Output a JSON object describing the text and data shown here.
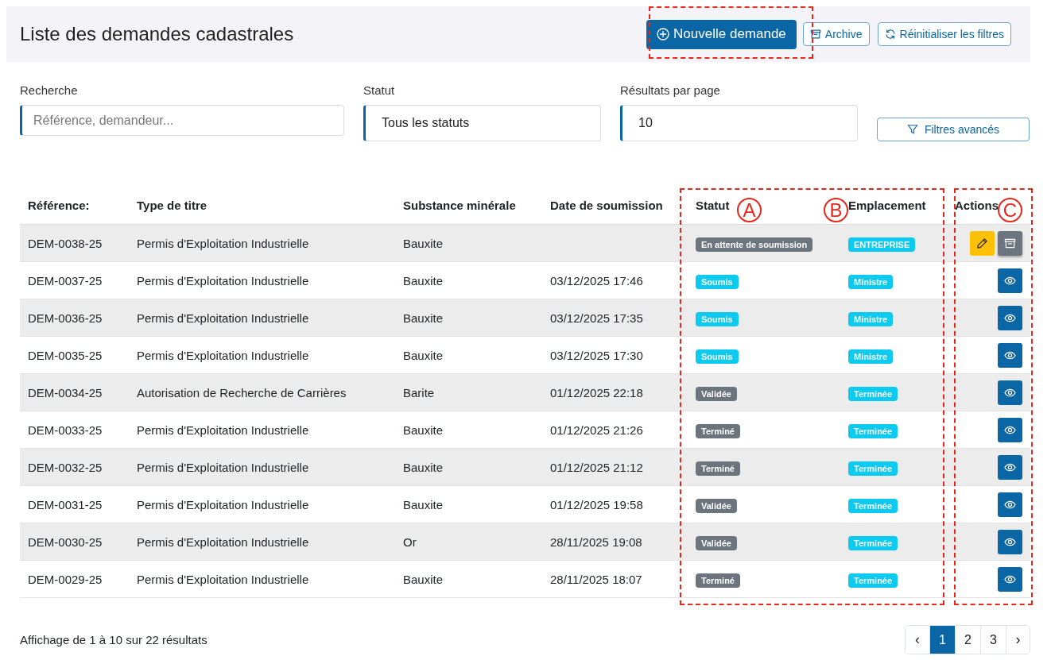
{
  "header": {
    "title": "Liste des demandes cadastrales",
    "buttons": [
      {
        "kind": "new",
        "label": "Nouvelle demande"
      },
      {
        "kind": "archive",
        "label": "Archive"
      },
      {
        "kind": "reset",
        "label": "Réinitialiser les filtres"
      }
    ]
  },
  "filters": {
    "search": {
      "label": "Recherche",
      "placeholder": "Référence, demandeur..."
    },
    "status": {
      "label": "Statut",
      "value": "Tous les statuts"
    },
    "per_page": {
      "label": "Résultats par page",
      "value": "10"
    },
    "advanced_button": "Filtres avancés"
  },
  "table": {
    "columns": [
      "Référence:",
      "Type de titre",
      "Substance minérale",
      "Date de soumission",
      "Statut",
      "Emplacement",
      "Actions"
    ],
    "rows": [
      {
        "ref": "DEM-0038-25",
        "type": "Permis d'Exploitation Industrielle",
        "substance": "Bauxite",
        "date": "",
        "status": {
          "text": "En attente de soumission",
          "color": "#6c757d"
        },
        "location": {
          "text": "ENTREPRISE",
          "color": "#0dcaf0"
        },
        "kind": "draft"
      },
      {
        "ref": "DEM-0037-25",
        "type": "Permis d'Exploitation Industrielle",
        "substance": "Bauxite",
        "date": "03/12/2025 17:46",
        "status": {
          "text": "Soumis",
          "color": "#0dcaf0"
        },
        "location": {
          "text": "Ministre",
          "color": "#0dcaf0"
        },
        "kind": "submitted"
      },
      {
        "ref": "DEM-0036-25",
        "type": "Permis d'Exploitation Industrielle",
        "substance": "Bauxite",
        "date": "03/12/2025 17:35",
        "status": {
          "text": "Soumis",
          "color": "#0dcaf0"
        },
        "location": {
          "text": "Ministre",
          "color": "#0dcaf0"
        },
        "kind": "submitted"
      },
      {
        "ref": "DEM-0035-25",
        "type": "Permis d'Exploitation Industrielle",
        "substance": "Bauxite",
        "date": "03/12/2025 17:30",
        "status": {
          "text": "Soumis",
          "color": "#0dcaf0"
        },
        "location": {
          "text": "Ministre",
          "color": "#0dcaf0"
        },
        "kind": "submitted"
      },
      {
        "ref": "DEM-0034-25",
        "type": "Autorisation de Recherche de Carrières",
        "substance": "Barite",
        "date": "01/12/2025 22:18",
        "status": {
          "text": "Validée",
          "color": "#6c757d"
        },
        "location": {
          "text": "Terminée",
          "color": "#0dcaf0"
        },
        "kind": "submitted"
      },
      {
        "ref": "DEM-0033-25",
        "type": "Permis d'Exploitation Industrielle",
        "substance": "Bauxite",
        "date": "01/12/2025 21:26",
        "status": {
          "text": "Terminé",
          "color": "#6c757d"
        },
        "location": {
          "text": "Terminée",
          "color": "#0dcaf0"
        },
        "kind": "submitted"
      },
      {
        "ref": "DEM-0032-25",
        "type": "Permis d'Exploitation Industrielle",
        "substance": "Bauxite",
        "date": "01/12/2025 21:12",
        "status": {
          "text": "Terminé",
          "color": "#6c757d"
        },
        "location": {
          "text": "Terminée",
          "color": "#0dcaf0"
        },
        "kind": "submitted"
      },
      {
        "ref": "DEM-0031-25",
        "type": "Permis d'Exploitation Industrielle",
        "substance": "Bauxite",
        "date": "01/12/2025 19:58",
        "status": {
          "text": "Validée",
          "color": "#6c757d"
        },
        "location": {
          "text": "Terminée",
          "color": "#0dcaf0"
        },
        "kind": "submitted"
      },
      {
        "ref": "DEM-0030-25",
        "type": "Permis d'Exploitation Industrielle",
        "substance": "Or",
        "date": "28/11/2025 19:08",
        "status": {
          "text": "Validée",
          "color": "#6c757d"
        },
        "location": {
          "text": "Terminée",
          "color": "#0dcaf0"
        },
        "kind": "submitted"
      },
      {
        "ref": "DEM-0029-25",
        "type": "Permis d'Exploitation Industrielle",
        "substance": "Bauxite",
        "date": "28/11/2025 18:07",
        "status": {
          "text": "Terminé",
          "color": "#6c757d"
        },
        "location": {
          "text": "Terminée",
          "color": "#0dcaf0"
        },
        "kind": "submitted"
      }
    ]
  },
  "footer": {
    "summary": "Affichage de 1 à 10 sur 22 résultats",
    "pagination": [
      {
        "label": "‹",
        "kind": "prev",
        "selected": false
      },
      {
        "label": "1",
        "kind": "page",
        "selected": true
      },
      {
        "label": "2",
        "kind": "page",
        "selected": false
      },
      {
        "label": "3",
        "kind": "page",
        "selected": false
      },
      {
        "label": "›",
        "kind": "next",
        "selected": false
      }
    ]
  },
  "annotations": [
    {
      "kind": "box"
    },
    {
      "kind": "box"
    },
    {
      "kind": "box"
    },
    {
      "kind": "marker",
      "label": "A"
    },
    {
      "kind": "marker",
      "label": "B"
    },
    {
      "kind": "marker",
      "label": "C"
    }
  ]
}
